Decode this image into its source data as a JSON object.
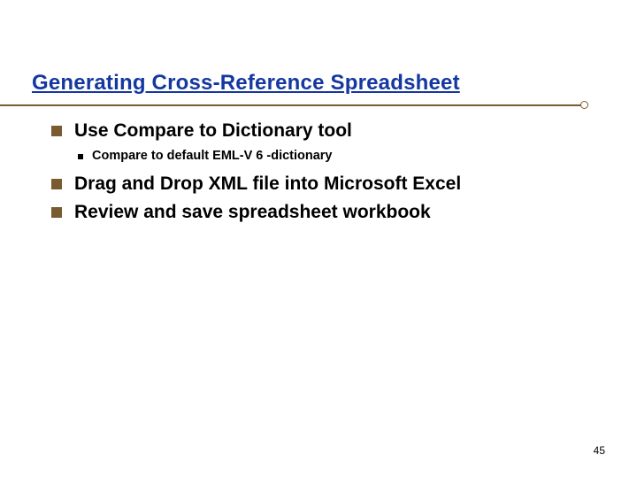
{
  "title": "Generating Cross-Reference Spreadsheet",
  "bullets": [
    {
      "text": "Use Compare to Dictionary tool",
      "sub": [
        {
          "text": "Compare to default EML-V 6 -dictionary"
        }
      ]
    },
    {
      "text": "Drag and Drop XML file into Microsoft Excel",
      "sub": []
    },
    {
      "text": "Review and save spreadsheet workbook",
      "sub": []
    }
  ],
  "page_number": "45"
}
